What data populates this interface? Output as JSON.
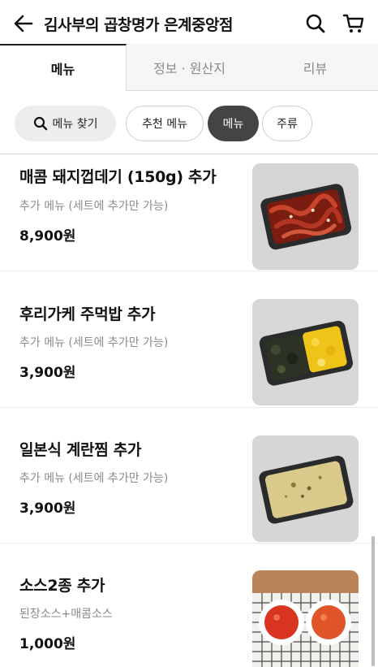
{
  "header": {
    "title": "김사부의 곱창명가 은계중앙점",
    "back_icon": "arrow-left-icon",
    "search_icon": "search-icon",
    "cart_icon": "cart-icon"
  },
  "tabs": [
    {
      "label": "메뉴",
      "active": true
    },
    {
      "label": "정보 · 원산지",
      "active": false
    },
    {
      "label": "리뷰",
      "active": false
    }
  ],
  "filters": {
    "search_label": "메뉴 찾기",
    "chips": [
      {
        "label": "추천 메뉴",
        "selected": false
      },
      {
        "label": "메뉴",
        "selected": true
      },
      {
        "label": "주류",
        "selected": false
      }
    ]
  },
  "menu_items": [
    {
      "name": "매콤 돼지껍데기 (150g) 추가",
      "description": "추가 메뉴 (세트에 추가만 가능)",
      "price": "8,900원",
      "photo": "spicy-pork-skin-tray"
    },
    {
      "name": "후리가케 주먹밥 추가",
      "description": "추가 메뉴 (세트에 추가만 가능)",
      "price": "3,900원",
      "photo": "furikake-rice-ball-tray"
    },
    {
      "name": "일본식 계란찜 추가",
      "description": "추가 메뉴 (세트에 추가만 가능)",
      "price": "3,900원",
      "photo": "japanese-steamed-egg-tray"
    },
    {
      "name": "소스2종 추가",
      "description": "된장소스+매콤소스",
      "price": "1,000원",
      "photo": "two-sauces-bowls"
    }
  ],
  "colors": {
    "active_chip_bg": "#444444",
    "search_chip_bg": "#ededed",
    "text_primary": "#111111",
    "text_secondary": "#8a8a8a"
  }
}
